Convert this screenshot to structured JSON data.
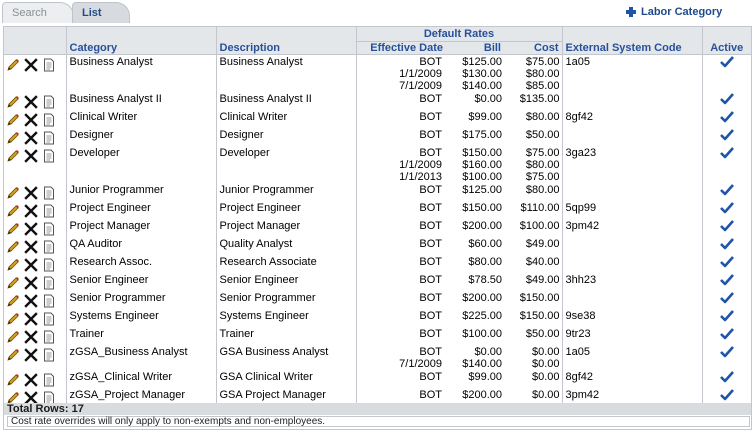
{
  "tabs": {
    "search": "Search",
    "list": "List"
  },
  "add_link": {
    "label": "Labor Category"
  },
  "table": {
    "group_header": "Default Rates",
    "headers": {
      "category": "Category",
      "description": "Description",
      "effective_date": "Effective Date",
      "bill": "Bill",
      "cost": "Cost",
      "external_code": "External System Code",
      "active": "Active"
    },
    "rows": [
      {
        "category": "Business Analyst",
        "description": "Business Analyst",
        "rates": [
          {
            "date": "BOT",
            "bill": "$125.00",
            "cost": "$75.00"
          },
          {
            "date": "1/1/2009",
            "bill": "$130.00",
            "cost": "$80.00"
          },
          {
            "date": "7/1/2009",
            "bill": "$140.00",
            "cost": "$85.00"
          }
        ],
        "code": "1a05"
      },
      {
        "category": "Business Analyst II",
        "description": "Business Analyst II",
        "rates": [
          {
            "date": "BOT",
            "bill": "$0.00",
            "cost": "$135.00"
          }
        ],
        "code": ""
      },
      {
        "category": "Clinical Writer",
        "description": "Clinical Writer",
        "rates": [
          {
            "date": "BOT",
            "bill": "$99.00",
            "cost": "$80.00"
          }
        ],
        "code": "8gf42"
      },
      {
        "category": "Designer",
        "description": "Designer",
        "rates": [
          {
            "date": "BOT",
            "bill": "$175.00",
            "cost": "$50.00"
          }
        ],
        "code": ""
      },
      {
        "category": "Developer",
        "description": "Developer",
        "rates": [
          {
            "date": "BOT",
            "bill": "$150.00",
            "cost": "$75.00"
          },
          {
            "date": "1/1/2009",
            "bill": "$160.00",
            "cost": "$80.00"
          },
          {
            "date": "1/1/2013",
            "bill": "$100.00",
            "cost": "$75.00"
          }
        ],
        "code": "3ga23"
      },
      {
        "category": "Junior Programmer",
        "description": "Junior Programmer",
        "rates": [
          {
            "date": "BOT",
            "bill": "$125.00",
            "cost": "$80.00"
          }
        ],
        "code": ""
      },
      {
        "category": "Project Engineer",
        "description": "Project Engineer",
        "rates": [
          {
            "date": "BOT",
            "bill": "$150.00",
            "cost": "$110.00"
          }
        ],
        "code": "5qp99"
      },
      {
        "category": "Project Manager",
        "description": "Project Manager",
        "rates": [
          {
            "date": "BOT",
            "bill": "$200.00",
            "cost": "$100.00"
          }
        ],
        "code": "3pm42"
      },
      {
        "category": "QA Auditor",
        "description": "Quality Analyst",
        "rates": [
          {
            "date": "BOT",
            "bill": "$60.00",
            "cost": "$49.00"
          }
        ],
        "code": ""
      },
      {
        "category": "Research Assoc.",
        "description": "Research Associate",
        "rates": [
          {
            "date": "BOT",
            "bill": "$80.00",
            "cost": "$40.00"
          }
        ],
        "code": ""
      },
      {
        "category": "Senior Engineer",
        "description": "Senior Engineer",
        "rates": [
          {
            "date": "BOT",
            "bill": "$78.50",
            "cost": "$49.00"
          }
        ],
        "code": "3hh23"
      },
      {
        "category": "Senior Programmer",
        "description": "Senior Programmer",
        "rates": [
          {
            "date": "BOT",
            "bill": "$200.00",
            "cost": "$150.00"
          }
        ],
        "code": ""
      },
      {
        "category": "Systems Engineer",
        "description": "Systems Engineer",
        "rates": [
          {
            "date": "BOT",
            "bill": "$225.00",
            "cost": "$150.00"
          }
        ],
        "code": "9se38"
      },
      {
        "category": "Trainer",
        "description": "Trainer",
        "rates": [
          {
            "date": "BOT",
            "bill": "$100.00",
            "cost": "$50.00"
          }
        ],
        "code": "9tr23"
      },
      {
        "category": "zGSA_Business Analyst",
        "description": "GSA Business Analyst",
        "rates": [
          {
            "date": "BOT",
            "bill": "$0.00",
            "cost": "$0.00"
          },
          {
            "date": "7/1/2009",
            "bill": "$140.00",
            "cost": "$0.00"
          }
        ],
        "code": "1a05"
      },
      {
        "category": "zGSA_Clinical Writer",
        "description": "GSA Clinical Writer",
        "rates": [
          {
            "date": "BOT",
            "bill": "$99.00",
            "cost": "$0.00"
          }
        ],
        "code": "8gf42"
      },
      {
        "category": "zGSA_Project Manager",
        "description": "GSA Project Manager",
        "rates": [
          {
            "date": "BOT",
            "bill": "$200.00",
            "cost": "$0.00"
          }
        ],
        "code": "3pm42"
      }
    ]
  },
  "icons": {
    "edit": "pencil-icon",
    "delete": "delete-x-icon",
    "details": "document-icon",
    "active": "checkmark-icon"
  },
  "colors": {
    "header_text": "#27509a",
    "header_bg": "#e4e7ea",
    "checkmark": "#1f55a8"
  },
  "footer": {
    "total": "Total Rows: 17",
    "note": "Cost rate overrides will only apply to non-exempts and non-employees."
  }
}
